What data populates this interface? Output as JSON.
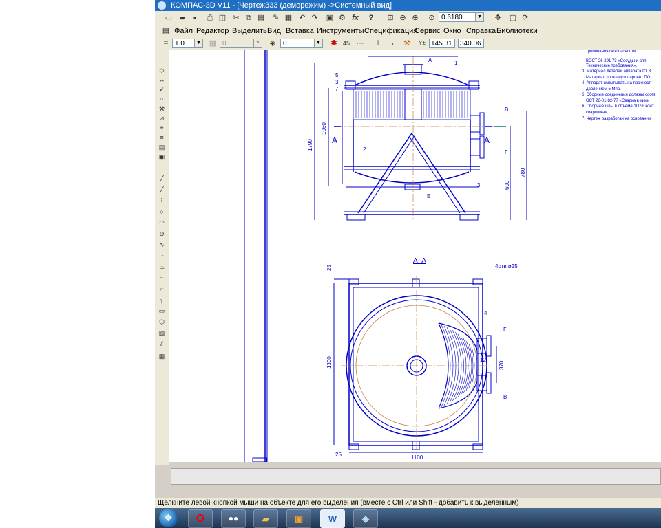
{
  "window": {
    "title": "КОМПАС-3D V11 - [Чертеж333 (деморежим) ->Системный вид]"
  },
  "toolbar": {
    "zoom_value": "0.6180",
    "fx_label": "fx",
    "help_label": "?"
  },
  "menu": {
    "items": [
      "Файл",
      "Редактор",
      "Выделить",
      "Вид",
      "Вставка",
      "Инструменты",
      "Спецификация",
      "Сервис",
      "Окно",
      "Справка",
      "Библиотеки"
    ]
  },
  "properties_bar": {
    "step_value": "1.0",
    "layer_value": "0",
    "style_value": "0",
    "angle_value": "45",
    "coord_x": "145.31",
    "coord_y": "340.06"
  },
  "drawing": {
    "main_view": {
      "section_marks": [
        "A",
        "A"
      ],
      "leader_numbers": [
        "1",
        "2",
        "3",
        "5",
        "3",
        "7"
      ],
      "nozzle_letters": [
        "А",
        "Б",
        "В",
        "Г"
      ],
      "dimensions": [
        "1790",
        "1060",
        "600",
        "780"
      ]
    },
    "section_view": {
      "title": "А–А",
      "hole_note": "4отв.ø25",
      "leader_numbers": [
        "4",
        "12"
      ],
      "nozzle_letters": [
        "Г",
        "В"
      ],
      "dimensions": [
        "25",
        "1300",
        "1100",
        "25",
        "370"
      ]
    },
    "notes": [
      "требования безопасности.",
      "ВОСТ 26 291 73 «Сосуды и апп",
      "Технические требования».",
      "3. Материал деталей аппарата Ст 3",
      "Материал прокладок паронит ПО",
      "4. Аппарат испытывать на прочност",
      "давлением 5 Мпа.",
      "5. Сборные соединения должны соотв",
      "ОСТ 26-01-82-77 «Сварка в хими",
      "6. Сборные швы в объеме 100% конт",
      "сварщикам.",
      "7. Чертеж разработан на основании"
    ]
  },
  "status": {
    "message": "Щелкните левой кнопкой мыши на объекте для его выделения (вместе с Ctrl или Shift - добавить к выделенным)"
  },
  "taskbar": {
    "apps": [
      "start-orb",
      "opera",
      "app-eyes",
      "folder",
      "compass",
      "word",
      "box"
    ],
    "word_label": "W"
  },
  "colors": {
    "drawing_lines": "#0000cc",
    "title_bar": "#1f6fc4",
    "toolbar_bg": "#ece9d8"
  }
}
